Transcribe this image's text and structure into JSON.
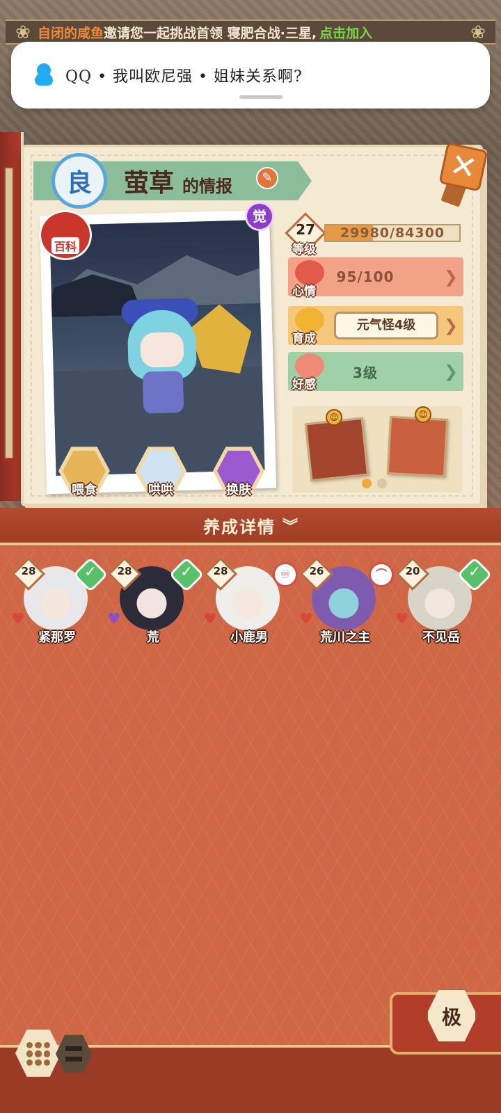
{
  "banner": {
    "inviter": "自闭的咸鱼",
    "message": "邀请您一起挑战首领 寝肥合战·三星,",
    "join_label": "点击加入"
  },
  "notification": {
    "app": "QQ",
    "sender": "我叫欧尼强",
    "text": "姐妹关系啊?",
    "full": "QQ • 我叫欧尼强 • 姐妹关系啊?"
  },
  "shikigami": {
    "rarity": "良",
    "name": "萤草",
    "title_suffix": "的情报",
    "awakened_badge": "觉",
    "baike_label": "百科",
    "level": "27",
    "level_label": "等级",
    "exp_text": "29980/84300",
    "exp_progress": 0.3556,
    "mood_label": "心情",
    "mood_value": "95/100",
    "growth_label": "育成",
    "growth_value": "元气怪4级",
    "favor_label": "好感",
    "favor_value": "3级"
  },
  "actions": [
    {
      "label": "喂食",
      "icon": "food-bowl-icon"
    },
    {
      "label": "哄哄",
      "icon": "milk-carton-icon"
    },
    {
      "label": "换肤",
      "icon": "kimono-icon"
    }
  ],
  "details_label": "养成详情",
  "roster": [
    {
      "level": "28",
      "name": "紧那罗",
      "badge": "check",
      "heart": "red",
      "hair": "#e8e8ea",
      "face": "#f5e6dc"
    },
    {
      "level": "28",
      "name": "荒",
      "badge": "check",
      "heart": "purple",
      "hair": "#2c2b3a",
      "face": "#f2e4e0"
    },
    {
      "level": "28",
      "name": "小鹿男",
      "badge": "ring",
      "ring_symbol": "♾",
      "heart": "red",
      "hair": "#f0eeea",
      "face": "#f7e8de"
    },
    {
      "level": "26",
      "name": "荒川之主",
      "badge": "ring",
      "ring_symbol": "⌒",
      "heart": "red",
      "hair": "#7f5bb0",
      "face": "#8fd1dc"
    },
    {
      "level": "20",
      "name": "不见岳",
      "badge": "check",
      "heart": "red",
      "hair": "#d8d5c8",
      "face": "#f3e6dc"
    }
  ],
  "extreme_label": "极",
  "colors": {
    "accent_orange": "#e59a46",
    "mood_row": "#f2a287",
    "growth_row": "#f5c77a",
    "favor_row": "#9fd0a8",
    "check_green": "#59c06a"
  }
}
